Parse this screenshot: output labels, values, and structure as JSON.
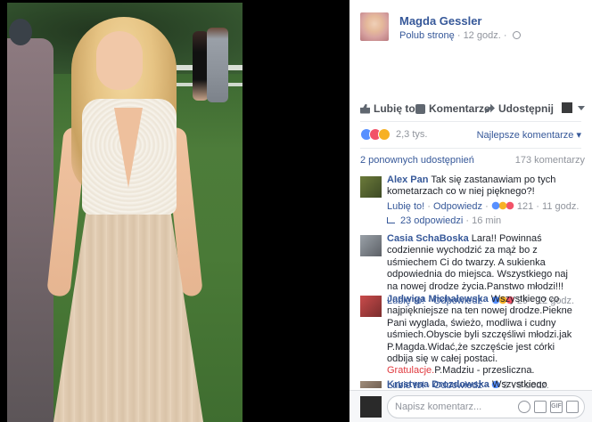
{
  "photo": {
    "alt": ""
  },
  "post": {
    "page_name": "Magda Gessler",
    "like_page": "Polub stronę",
    "time": "12 godz."
  },
  "actions": {
    "like": "Lubię to!",
    "comment": "Komentarze",
    "share": "Udostępnij"
  },
  "reactions": {
    "count": "2,3 tys.",
    "sort_label": "Najlepsze komentarze"
  },
  "shares": "2 ponownych udostępnień",
  "comment_count": "173 komentarzy",
  "comments": [
    {
      "name": "Alex Pan",
      "text": "Tak się zastanawiam po tych kometarzach co w niej pięknego?!",
      "like": "Lubię to!",
      "reply": "Odpowiedz",
      "reactions": "121",
      "time": "11 godz.",
      "replies": "23 odpowiedzi",
      "replies_time": "16 min"
    },
    {
      "name": "Casia SchaBoska",
      "text": "Lara!! Powinnaś codziennie wychodzić za mąż bo z uśmiechem Ci do twarzy. A sukienka odpowiednia do miejsca. Wszystkiego naj na nowej drodze życia.Panstwo młodzi!!!",
      "like": "Lubię to!",
      "reply": "Odpowiedz",
      "reactions": "29",
      "time": "12 godz."
    },
    {
      "name": "Jadwiga Michałewska",
      "text_a": "Wszystkiego co najpiękniejsze na ten nowej drodze.Piekne Pani wyglada, świeżo, modliwa i cudny uśmiech.Obyscie byli szczęśliwi młodzi.jak P.Magda.Widać,że szczęście jest córki odbija się w całej postaci.",
      "text_highlight": "Gratulacje.",
      "text_b": "P.Madziu - przesliczna.",
      "like": "Lubię to!",
      "reply": "Odpowiedz",
      "reactions": "2",
      "time": "8 godz."
    },
    {
      "name": "Krystyna Drozdowska",
      "text": "Wszystkiego"
    }
  ],
  "comment_input": {
    "placeholder": "Napisz komentarz..."
  },
  "colors": {
    "link": "#365899",
    "meta": "#90949c",
    "highlight": "#e0393e"
  }
}
